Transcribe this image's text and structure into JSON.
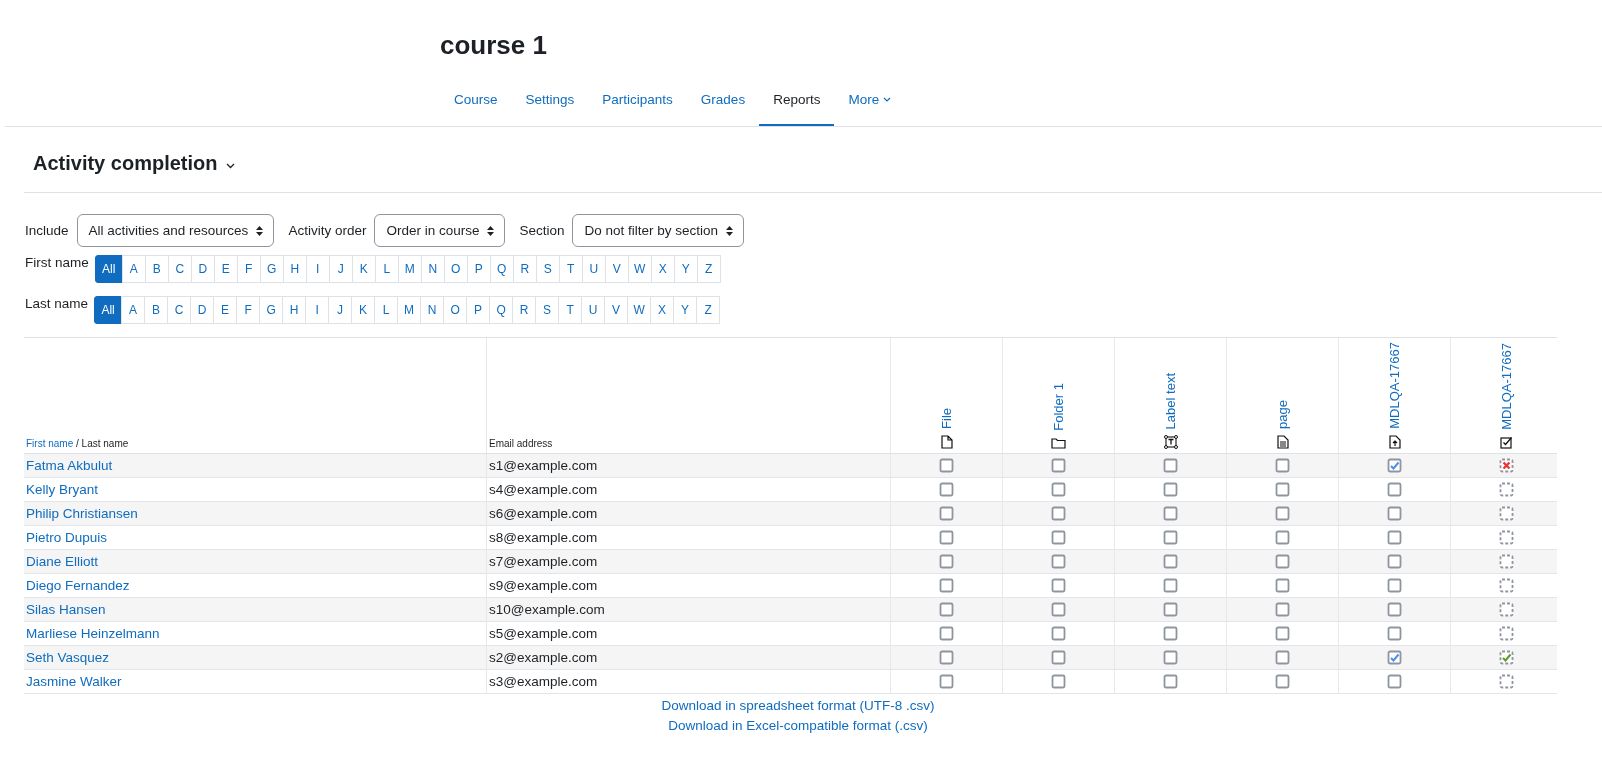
{
  "course_title": "course 1",
  "nav_tabs": [
    {
      "label": "Course",
      "selected": false
    },
    {
      "label": "Settings",
      "selected": false
    },
    {
      "label": "Participants",
      "selected": false
    },
    {
      "label": "Grades",
      "selected": false
    },
    {
      "label": "Reports",
      "selected": true
    },
    {
      "label": "More",
      "selected": false,
      "kind": "dropdown"
    }
  ],
  "page_heading": "Activity completion",
  "filters": [
    {
      "label": "Include",
      "value": "All activities and resources"
    },
    {
      "label": "Activity order",
      "value": "Order in course"
    },
    {
      "label": "Section",
      "value": "Do not filter by section"
    }
  ],
  "initials_bars": [
    {
      "label": "First name",
      "letters": [
        {
          "text": "All",
          "selected": true
        },
        {
          "text": "A",
          "selected": false
        },
        {
          "text": "B",
          "selected": false
        },
        {
          "text": "C",
          "selected": false
        },
        {
          "text": "D",
          "selected": false
        },
        {
          "text": "E",
          "selected": false
        },
        {
          "text": "F",
          "selected": false
        },
        {
          "text": "G",
          "selected": false
        },
        {
          "text": "H",
          "selected": false
        },
        {
          "text": "I",
          "selected": false
        },
        {
          "text": "J",
          "selected": false
        },
        {
          "text": "K",
          "selected": false
        },
        {
          "text": "L",
          "selected": false
        },
        {
          "text": "M",
          "selected": false
        },
        {
          "text": "N",
          "selected": false
        },
        {
          "text": "O",
          "selected": false
        },
        {
          "text": "P",
          "selected": false
        },
        {
          "text": "Q",
          "selected": false
        },
        {
          "text": "R",
          "selected": false
        },
        {
          "text": "S",
          "selected": false
        },
        {
          "text": "T",
          "selected": false
        },
        {
          "text": "U",
          "selected": false
        },
        {
          "text": "V",
          "selected": false
        },
        {
          "text": "W",
          "selected": false
        },
        {
          "text": "X",
          "selected": false
        },
        {
          "text": "Y",
          "selected": false
        },
        {
          "text": "Z",
          "selected": false
        }
      ]
    },
    {
      "label": "Last name",
      "letters": [
        {
          "text": "All",
          "selected": true
        },
        {
          "text": "A",
          "selected": false
        },
        {
          "text": "B",
          "selected": false
        },
        {
          "text": "C",
          "selected": false
        },
        {
          "text": "D",
          "selected": false
        },
        {
          "text": "E",
          "selected": false
        },
        {
          "text": "F",
          "selected": false
        },
        {
          "text": "G",
          "selected": false
        },
        {
          "text": "H",
          "selected": false
        },
        {
          "text": "I",
          "selected": false
        },
        {
          "text": "J",
          "selected": false
        },
        {
          "text": "K",
          "selected": false
        },
        {
          "text": "L",
          "selected": false
        },
        {
          "text": "M",
          "selected": false
        },
        {
          "text": "N",
          "selected": false
        },
        {
          "text": "O",
          "selected": false
        },
        {
          "text": "P",
          "selected": false
        },
        {
          "text": "Q",
          "selected": false
        },
        {
          "text": "R",
          "selected": false
        },
        {
          "text": "S",
          "selected": false
        },
        {
          "text": "T",
          "selected": false
        },
        {
          "text": "U",
          "selected": false
        },
        {
          "text": "V",
          "selected": false
        },
        {
          "text": "W",
          "selected": false
        },
        {
          "text": "X",
          "selected": false
        },
        {
          "text": "Y",
          "selected": false
        },
        {
          "text": "Z",
          "selected": false
        }
      ]
    }
  ],
  "table": {
    "name_header": {
      "first": "First name",
      "separator": " / ",
      "last": "Last name"
    },
    "email_header": "Email address",
    "activities": [
      {
        "name": "File",
        "kind": "file",
        "automatic": false
      },
      {
        "name": "Folder 1",
        "kind": "folder",
        "automatic": false
      },
      {
        "name": "Label text",
        "kind": "label",
        "automatic": false
      },
      {
        "name": "page",
        "kind": "page",
        "automatic": false
      },
      {
        "name": "MDLQA-17667",
        "kind": "assignment",
        "automatic": false
      },
      {
        "name": "MDLQA-17667",
        "kind": "checklist",
        "automatic": true
      }
    ],
    "rows": [
      {
        "name": "Fatma Akbulut",
        "email": "s1@example.com",
        "cells": [
          {
            "complete": false,
            "failed": false
          },
          {
            "complete": false,
            "failed": false
          },
          {
            "complete": false,
            "failed": false
          },
          {
            "complete": false,
            "failed": false
          },
          {
            "complete": true,
            "failed": false
          },
          {
            "complete": false,
            "failed": true
          }
        ]
      },
      {
        "name": "Kelly Bryant",
        "email": "s4@example.com",
        "cells": [
          {
            "complete": false,
            "failed": false
          },
          {
            "complete": false,
            "failed": false
          },
          {
            "complete": false,
            "failed": false
          },
          {
            "complete": false,
            "failed": false
          },
          {
            "complete": false,
            "failed": false
          },
          {
            "complete": false,
            "failed": false
          }
        ]
      },
      {
        "name": "Philip Christiansen",
        "email": "s6@example.com",
        "cells": [
          {
            "complete": false,
            "failed": false
          },
          {
            "complete": false,
            "failed": false
          },
          {
            "complete": false,
            "failed": false
          },
          {
            "complete": false,
            "failed": false
          },
          {
            "complete": false,
            "failed": false
          },
          {
            "complete": false,
            "failed": false
          }
        ]
      },
      {
        "name": "Pietro Dupuis",
        "email": "s8@example.com",
        "cells": [
          {
            "complete": false,
            "failed": false
          },
          {
            "complete": false,
            "failed": false
          },
          {
            "complete": false,
            "failed": false
          },
          {
            "complete": false,
            "failed": false
          },
          {
            "complete": false,
            "failed": false
          },
          {
            "complete": false,
            "failed": false
          }
        ]
      },
      {
        "name": "Diane Elliott",
        "email": "s7@example.com",
        "cells": [
          {
            "complete": false,
            "failed": false
          },
          {
            "complete": false,
            "failed": false
          },
          {
            "complete": false,
            "failed": false
          },
          {
            "complete": false,
            "failed": false
          },
          {
            "complete": false,
            "failed": false
          },
          {
            "complete": false,
            "failed": false
          }
        ]
      },
      {
        "name": "Diego Fernandez",
        "email": "s9@example.com",
        "cells": [
          {
            "complete": false,
            "failed": false
          },
          {
            "complete": false,
            "failed": false
          },
          {
            "complete": false,
            "failed": false
          },
          {
            "complete": false,
            "failed": false
          },
          {
            "complete": false,
            "failed": false
          },
          {
            "complete": false,
            "failed": false
          }
        ]
      },
      {
        "name": "Silas Hansen",
        "email": "s10@example.com",
        "cells": [
          {
            "complete": false,
            "failed": false
          },
          {
            "complete": false,
            "failed": false
          },
          {
            "complete": false,
            "failed": false
          },
          {
            "complete": false,
            "failed": false
          },
          {
            "complete": false,
            "failed": false
          },
          {
            "complete": false,
            "failed": false
          }
        ]
      },
      {
        "name": "Marliese Heinzelmann",
        "email": "s5@example.com",
        "cells": [
          {
            "complete": false,
            "failed": false
          },
          {
            "complete": false,
            "failed": false
          },
          {
            "complete": false,
            "failed": false
          },
          {
            "complete": false,
            "failed": false
          },
          {
            "complete": false,
            "failed": false
          },
          {
            "complete": false,
            "failed": false
          }
        ]
      },
      {
        "name": "Seth Vasquez",
        "email": "s2@example.com",
        "cells": [
          {
            "complete": false,
            "failed": false
          },
          {
            "complete": false,
            "failed": false
          },
          {
            "complete": false,
            "failed": false
          },
          {
            "complete": false,
            "failed": false
          },
          {
            "complete": true,
            "failed": false
          },
          {
            "complete": true,
            "failed": false
          }
        ]
      },
      {
        "name": "Jasmine Walker",
        "email": "s3@example.com",
        "cells": [
          {
            "complete": false,
            "failed": false
          },
          {
            "complete": false,
            "failed": false
          },
          {
            "complete": false,
            "failed": false
          },
          {
            "complete": false,
            "failed": false
          },
          {
            "complete": false,
            "failed": false
          },
          {
            "complete": false,
            "failed": false
          }
        ]
      }
    ]
  },
  "download_links": [
    "Download in spreadsheet format (UTF-8 .csv)",
    "Download in Excel-compatible format (.csv)"
  ]
}
